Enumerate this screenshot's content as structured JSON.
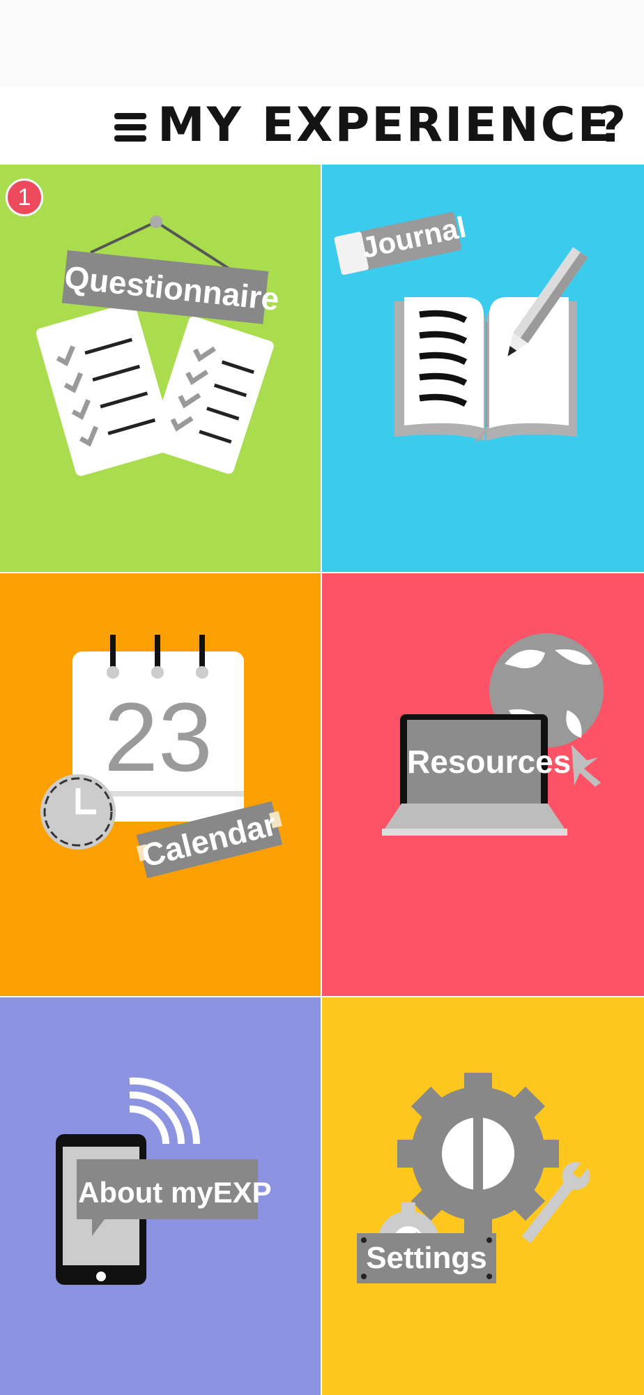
{
  "header": {
    "title": "MY EXPERIENCE",
    "help_label": "?"
  },
  "tiles": [
    {
      "label": "Questionnaire",
      "color": "#a9dd4e",
      "icon": "questionnaire-icon",
      "badge": "1"
    },
    {
      "label": "Journal",
      "color": "#3acbed",
      "icon": "journal-icon"
    },
    {
      "label": "Calendar",
      "color": "#fda102",
      "icon": "calendar-icon",
      "date": "23"
    },
    {
      "label": "Resources",
      "color": "#fe5367",
      "icon": "resources-icon"
    },
    {
      "label": "About myEXP",
      "color": "#8c94e2",
      "icon": "about-phone-icon"
    },
    {
      "label": "Settings",
      "color": "#fec71d",
      "icon": "settings-gear-icon"
    }
  ]
}
